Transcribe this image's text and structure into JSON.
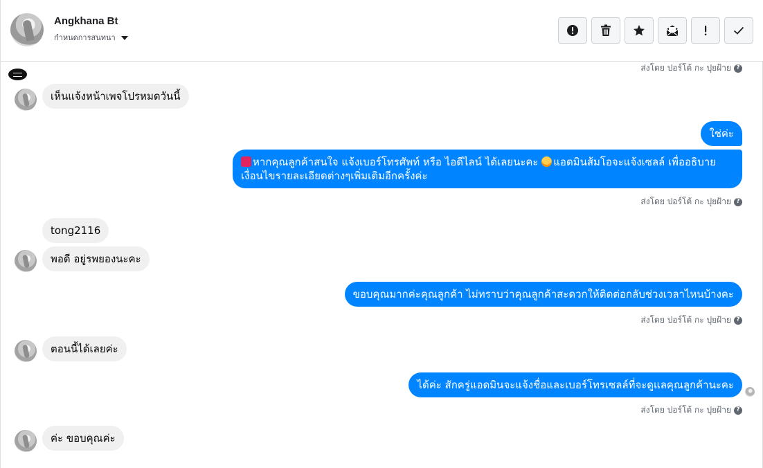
{
  "header": {
    "contact_name": "Angkhana Bt",
    "subtitle": "กำหนดการสนทนา"
  },
  "toolbar": {
    "buttons": [
      {
        "name": "spam-button",
        "icon": "exclamation-circle-icon"
      },
      {
        "name": "delete-button",
        "icon": "trash-icon"
      },
      {
        "name": "star-button",
        "icon": "star-icon"
      },
      {
        "name": "mark-unread-button",
        "icon": "envelope-open-icon"
      },
      {
        "name": "follow-up-button",
        "icon": "exclamation-icon"
      },
      {
        "name": "mark-done-button",
        "icon": "check-icon"
      }
    ]
  },
  "thread": {
    "sent_by_label": "ส่งโดย ปอร์โต้ กะ ปุยฝ้าย",
    "help_glyph": "?",
    "messages": [
      {
        "id": "m1",
        "direction": "in",
        "text": "เห็นแจ้งหน้าเพจโปรหมดวันนี้"
      },
      {
        "id": "m2",
        "direction": "out",
        "text": "ใช่ค่ะ"
      },
      {
        "id": "m3",
        "direction": "out",
        "text": "หากคุณลูกค้าสนใจ แจ้งเบอร์โทรศัพท์ หรือ ไอดีไลน์  ได้เลยนะคะ แอดมินส้มโอจะแจ้งเซลล์   เพื่ออธิบาย เงื่อนไขรายละเอียดต่างๆเพิ่มเติมอีกครั้งค่ะ",
        "prefix_emoji": "telephone-emoji",
        "inline_emoji": "smiling-face-with-hearts-emoji"
      },
      {
        "id": "m4",
        "direction": "in",
        "text": "tong2116"
      },
      {
        "id": "m5",
        "direction": "in",
        "text": "พอดี อยู่รพยองนะคะ"
      },
      {
        "id": "m6",
        "direction": "out",
        "text": "ขอบคุณมากค่ะคุณลูกค้า ไม่ทราบว่าคุณลูกค้าสะดวกให้ติดต่อกลับช่วงเวลาไหนบ้างคะ"
      },
      {
        "id": "m7",
        "direction": "in",
        "text": "ตอนนี้ได้เลยค่ะ"
      },
      {
        "id": "m8",
        "direction": "out",
        "text": "ได้ค่ะ สักครู่แอดมินจะแจ้งชื่อและเบอร์โทรเซลล์ที่จะดูแลคุณลูกค้านะคะ"
      },
      {
        "id": "m9",
        "direction": "in",
        "text": "ค่ะ ขอบคุณค่ะ"
      }
    ],
    "m3_part1": "หากคุณลูกค้าสนใจ แจ้งเบอร์โทรศัพท์ หรือ ไอดีไลน์  ได้เลยนะคะ ",
    "m3_part2": "แอดมินส้มโอจะแจ้งเซลล์   เพื่ออธิบาย เงื่อนไขรายละเอียดต่างๆเพิ่มเติมอีกครั้งค่ะ"
  },
  "colors": {
    "outgoing_bubble": "#0084ff",
    "incoming_bubble": "#f0f0f0",
    "meta_text": "#606770"
  }
}
